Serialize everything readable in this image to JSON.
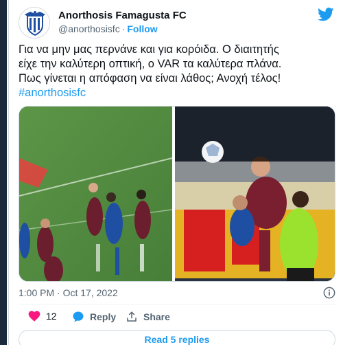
{
  "account": {
    "name": "Anorthosis Famagusta FC",
    "handle": "@anorthosisfc",
    "separator": "·",
    "follow_label": "Follow"
  },
  "tweet": {
    "lines": [
      "Για να μην μας περνάνε και για κορόιδα. Ο διαιτητής",
      "είχε την καλύτερη οπτική, ο VAR τα καλύτερα πλάνα.",
      "Πως γίνεται η απόφαση να είναι λάθος; Ανοχή τέλος!"
    ],
    "hashtag": "#anorthosisfc",
    "timestamp": "1:00 PM · Oct 17, 2022"
  },
  "actions": {
    "like_count": "12",
    "reply_label": "Reply",
    "share_label": "Share"
  },
  "read_replies_label": "Read 5 replies",
  "icons": {
    "brand": "twitter-bird-icon",
    "info": "info-icon",
    "like": "heart-icon",
    "reply": "reply-bubble-icon",
    "share": "share-upload-icon"
  },
  "colors": {
    "accent": "#1d9bf0",
    "like": "#f91880",
    "text": "#0f1419",
    "muted": "#536471"
  }
}
